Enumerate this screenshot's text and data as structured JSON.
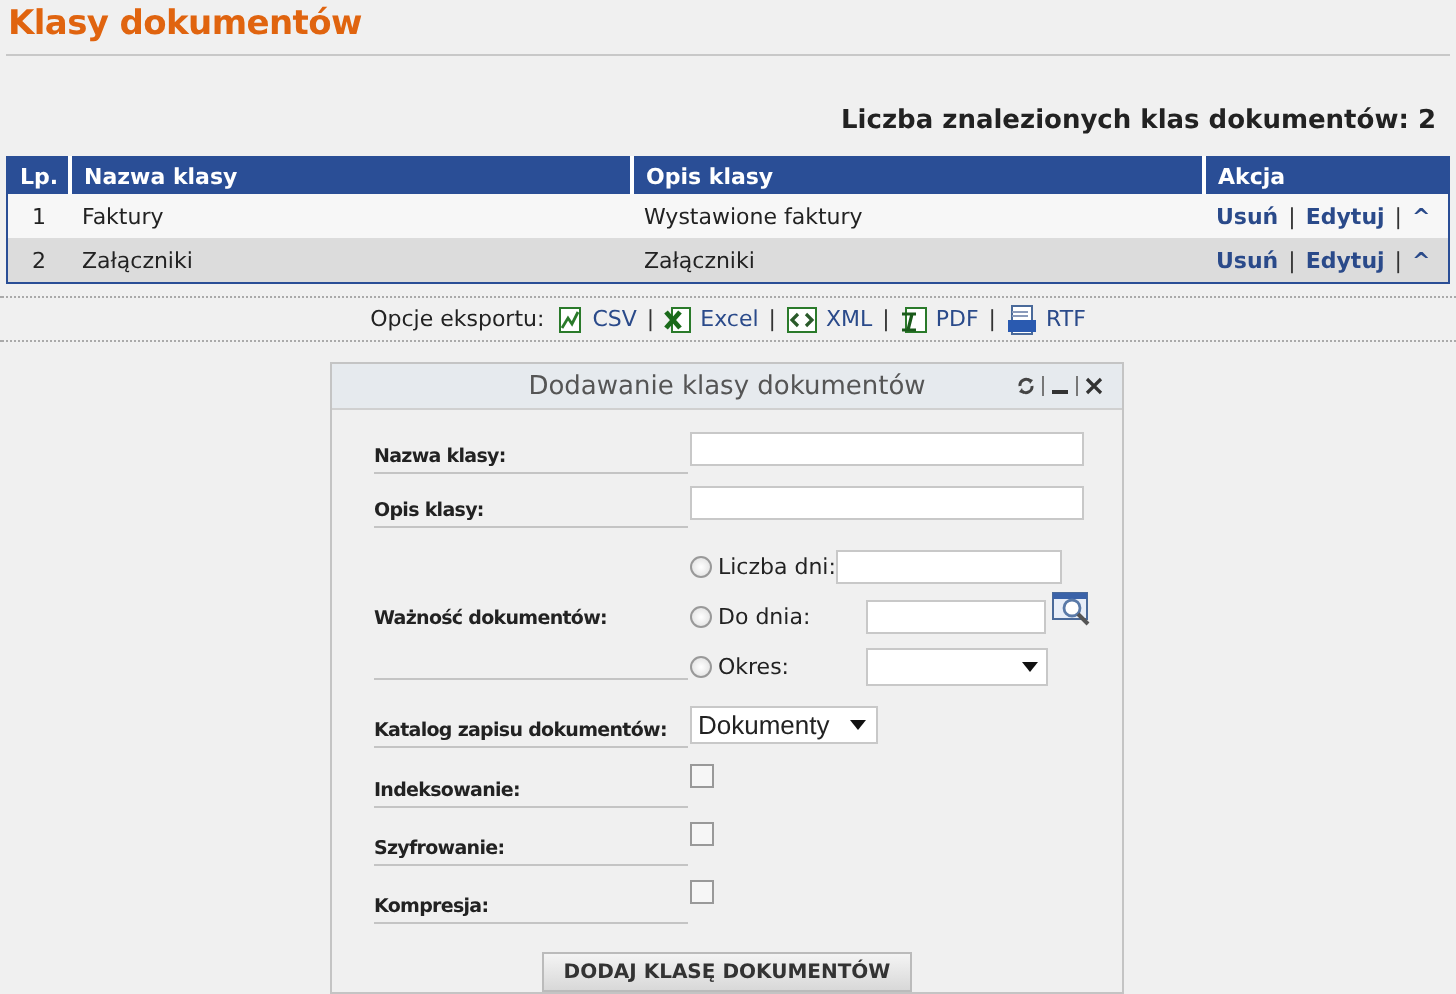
{
  "page": {
    "title": "Klasy dokumentów",
    "result_count": "Liczba znalezionych klas dokumentów: 2"
  },
  "table": {
    "columns": [
      "Lp.",
      "Nazwa klasy",
      "Opis klasy",
      "Akcja"
    ],
    "rows": [
      {
        "cells": [
          "1",
          "Faktury",
          "Wystawione faktury"
        ],
        "actions": [
          {
            "kind": "link",
            "label": "Usuń"
          },
          {
            "kind": "separator",
            "label": "|"
          },
          {
            "kind": "link",
            "label": "Edytuj"
          },
          {
            "kind": "separator",
            "label": "|"
          },
          {
            "kind": "link",
            "label": "^"
          }
        ]
      },
      {
        "cells": [
          "2",
          "Załączniki",
          "Załączniki"
        ],
        "actions": [
          {
            "kind": "link",
            "label": "Usuń"
          },
          {
            "kind": "separator",
            "label": "|"
          },
          {
            "kind": "link",
            "label": "Edytuj"
          },
          {
            "kind": "separator",
            "label": "|"
          },
          {
            "kind": "link",
            "label": "^"
          }
        ]
      }
    ]
  },
  "export": {
    "label": "Opcje eksportu:",
    "items": [
      {
        "kind": "csv",
        "label": "CSV"
      },
      {
        "kind": "separator",
        "label": "|"
      },
      {
        "kind": "excel",
        "label": "Excel"
      },
      {
        "kind": "separator",
        "label": "|"
      },
      {
        "kind": "xml",
        "label": "XML"
      },
      {
        "kind": "separator",
        "label": "|"
      },
      {
        "kind": "pdf",
        "label": "PDF"
      },
      {
        "kind": "separator",
        "label": "|"
      },
      {
        "kind": "rtf",
        "label": "RTF"
      }
    ]
  },
  "dialog": {
    "title": "Dodawanie klasy dokumentów",
    "fields": [
      {
        "kind": "text",
        "label": "Nazwa klasy:"
      },
      {
        "kind": "text",
        "label": "Opis klasy:"
      },
      {
        "kind": "validity",
        "label": "Ważność dokumentów:",
        "options": [
          {
            "label": "Liczba dni:",
            "selected": false,
            "kind": "text"
          },
          {
            "label": "Do dnia:",
            "selected": false,
            "kind": "date"
          },
          {
            "label": "Okres:",
            "selected": false,
            "kind": "select"
          }
        ]
      },
      {
        "kind": "select",
        "label": "Katalog zapisu dokumentów:",
        "value": "Dokumenty"
      },
      {
        "kind": "checkbox",
        "label": "Indeksowanie:",
        "checked": false
      },
      {
        "kind": "checkbox",
        "label": "Szyfrowanie:",
        "checked": false
      },
      {
        "kind": "checkbox",
        "label": "Kompresja:",
        "checked": false
      }
    ],
    "submit": "DODAJ KLASĘ DOKUMENTÓW"
  }
}
